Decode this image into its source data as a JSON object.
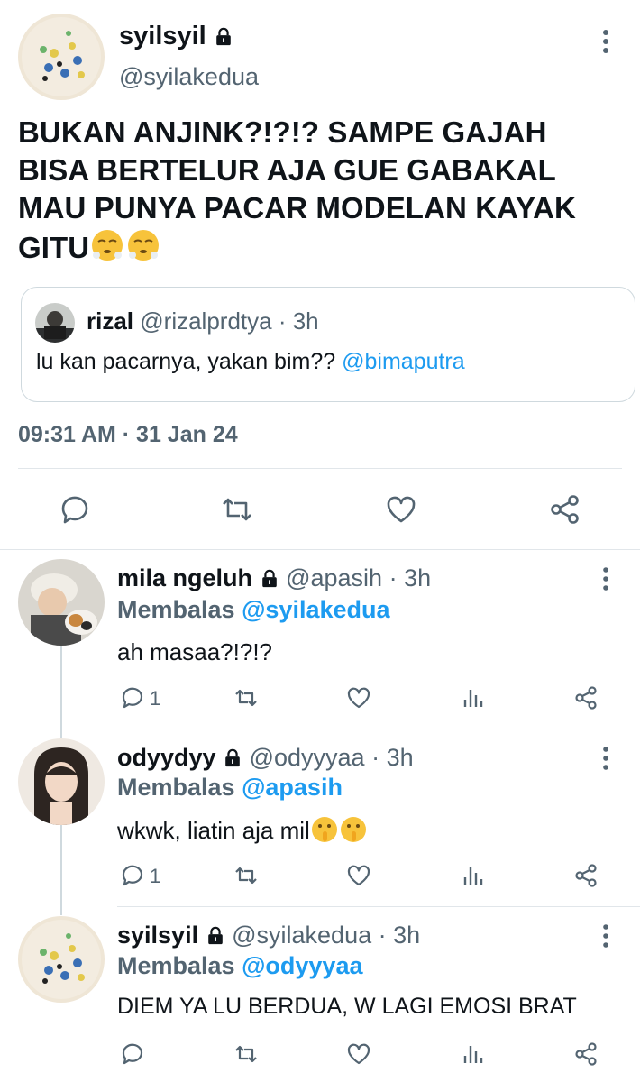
{
  "main_tweet": {
    "author_name": "syilsyil",
    "author_handle": "@syilakedua",
    "text": "BUKAN ANJINK?!?!? SAMPE GAJAH BISA BERTELUR AJA GUE GABAKAL MAU PUNYA PACAR MODELAN KAYAK GITU",
    "emoji": [
      "face-with-steam-emoji",
      "face-with-steam-emoji"
    ],
    "timestamp": "09:31 AM · 31 Jan 24",
    "quoted": {
      "author_name": "rizal",
      "author_handle": "@rizalprdtya",
      "time": "· 3h",
      "text": "lu kan pacarnya, yakan bim??",
      "mention": "@bimaputra"
    }
  },
  "replies": [
    {
      "author_name": "mila ngeluh",
      "author_handle": "@apasih",
      "time": "· 3h",
      "replying_label": "Membalas",
      "replying_to": "@syilakedua",
      "text": "ah masaa?!?!?",
      "reply_count": "1"
    },
    {
      "author_name": "odyydyy",
      "author_handle": "@odyyyaa",
      "time": "· 3h",
      "replying_label": "Membalas",
      "replying_to": "@apasih",
      "text": "wkwk, liatin aja mil",
      "emoji": [
        "shushing-face-emoji",
        "shushing-face-emoji"
      ],
      "reply_count": "1"
    },
    {
      "author_name": "syilsyil",
      "author_handle": "@syilakedua",
      "time": "· 3h",
      "replying_label": "Membalas",
      "replying_to": "@odyyyaa",
      "text": "DIEM YA LU BERDUA, W LAGI EMOSI BRAT",
      "reply_count": ""
    }
  ],
  "colors": {
    "link": "#1d9bf0",
    "muted": "#536471",
    "divider": "#e1e6ea",
    "text": "#0f1419"
  }
}
